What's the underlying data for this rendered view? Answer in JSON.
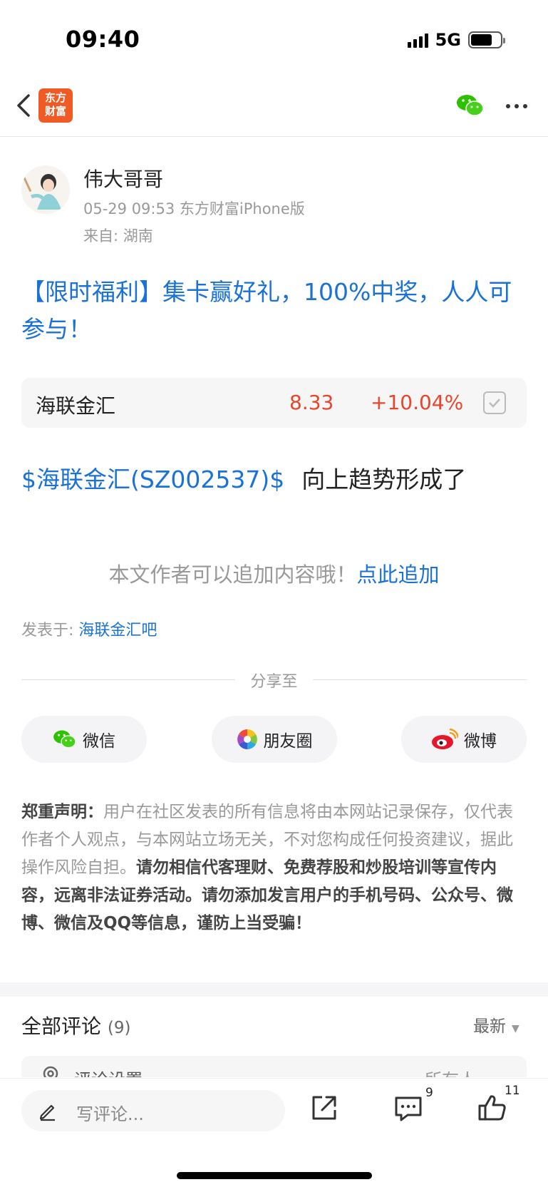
{
  "status_bar": {
    "time": "09:40",
    "network": "5G"
  },
  "nav": {
    "logo_line1": "东方",
    "logo_line2": "财富"
  },
  "author": {
    "name": "伟大哥哥",
    "meta": "05-29 09:53 东方财富iPhone版",
    "location": "来自: 湖南"
  },
  "post": {
    "title": "【限时福利】集卡赢好礼，100%中奖，人人可参与！",
    "stock": {
      "name": "海联金汇",
      "price": "8.33",
      "change": "+10.04%"
    },
    "stock_tag": "$海联金汇(SZ002537)$",
    "body": "向上趋势形成了",
    "add_prompt": "本文作者可以追加内容哦！",
    "add_link": "点此追加",
    "posted_in_label": "发表于: ",
    "posted_in_bar": "海联金汇吧"
  },
  "share": {
    "label": "分享至",
    "wechat": "微信",
    "moments": "朋友圈",
    "weibo": "微博"
  },
  "disclaimer": {
    "head": "郑重声明：",
    "normal": "用户在社区发表的所有信息将由本网站记录保存，仅代表作者个人观点，与本网站立场无关，不对您构成任何投资建议，据此操作风险自担。",
    "bold": "请勿相信代客理财、免费荐股和炒股培训等宣传内容，远离非法证券活动。请勿添加发言用户的手机号码、公众号、微博、微信及QQ等信息，谨防上当受骗！"
  },
  "comments": {
    "title": "全部评论",
    "count": "(9)",
    "sort": "最新",
    "settings_label": "评论设置",
    "settings_value": "所有人"
  },
  "bottom_bar": {
    "placeholder": "写评论...",
    "comment_count": "9",
    "like_count": "11"
  },
  "colors": {
    "link": "#1a72d6",
    "up": "#e8452a",
    "brand": "#f05a24",
    "wechat": "#2dc100"
  }
}
